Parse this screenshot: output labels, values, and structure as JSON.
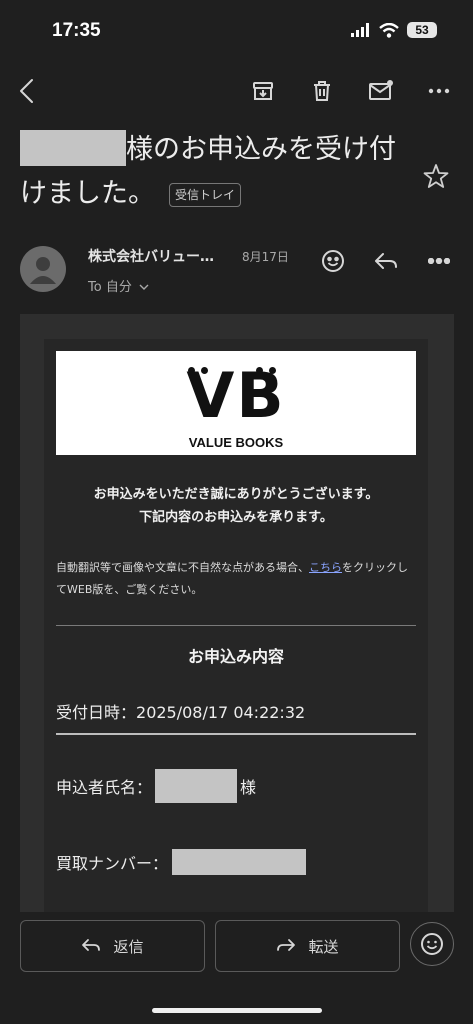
{
  "status_bar": {
    "time": "17:35",
    "battery": "53"
  },
  "email": {
    "subject_suffix": "様のお申込みを受け付けました。",
    "folder_tag": "受信トレイ",
    "sender": "株式会社バリュー…",
    "date": "8月17日",
    "to": "To 自分"
  },
  "body": {
    "logo_mark": "VB",
    "logo_text": "VALUE BOOKS",
    "greeting_line1": "お申込みをいただき誠にありがとうございます。",
    "greeting_line2": "下記内容のお申込みを承ります。",
    "notice_before": "自動翻訳等で画像や文章に不自然な点がある場合、",
    "notice_link": "こちら",
    "notice_after": "をクリックしてWEB版を、ご覧ください。",
    "section_title": "お申込み内容",
    "received_label": "受付日時：",
    "received_value": "2025/08/17 04:22:32",
    "applicant_label": "申込者氏名：",
    "applicant_suffix": "様",
    "buyback_label": "買取ナンバー："
  },
  "actions": {
    "reply": "返信",
    "forward": "転送"
  },
  "icons": {
    "back": "back-icon",
    "archive": "archive-icon",
    "trash": "trash-icon",
    "mark_unread": "mark-unread-icon",
    "more": "more-icon",
    "star": "star-icon",
    "emoji": "emoji-icon",
    "reply": "reply-icon",
    "forward": "forward-icon"
  }
}
